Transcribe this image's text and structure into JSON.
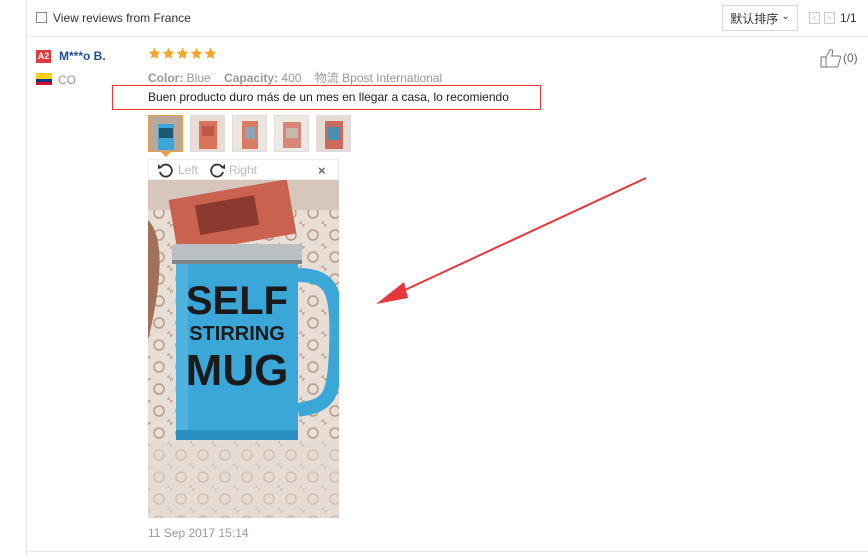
{
  "filter": {
    "label": "View reviews from France",
    "checked": false
  },
  "sort": {
    "label": "默认排序",
    "caret": "⌄"
  },
  "pagination": {
    "prev": "‹",
    "next": "›",
    "info": "1/1"
  },
  "reviewer": {
    "level": "A2",
    "name": "M***o B.",
    "country": "CO",
    "flag_colors": [
      "#FCD116",
      "#003893",
      "#CE1126"
    ]
  },
  "review": {
    "rating": 5,
    "attributes": [
      {
        "key": "Color:",
        "value": "Blue"
      },
      {
        "key": "Capacity:",
        "value": "400"
      },
      {
        "key": "物流",
        "value": "Bpost International"
      }
    ],
    "text": "Buen producto duro más de un mes en llegar a casa, lo recomiendo",
    "thumbnails": 5,
    "viewer": {
      "left_label": "Left",
      "right_label": "Right",
      "close": "×"
    },
    "photo_text": [
      "SELF",
      "STIRRING",
      "MUG"
    ],
    "date": "11 Sep 2017 15:14"
  },
  "helpful": {
    "count": "(0)"
  },
  "colors": {
    "accent_red": "#e4393c",
    "star": "#f5a623",
    "mug": "#3aa7d8",
    "username": "#1d4e9a"
  },
  "icons": [
    "checkbox-icon",
    "star-icon",
    "thumbs-up-icon",
    "rotate-left-icon",
    "rotate-right-icon",
    "close-icon",
    "arrow-annotation"
  ]
}
